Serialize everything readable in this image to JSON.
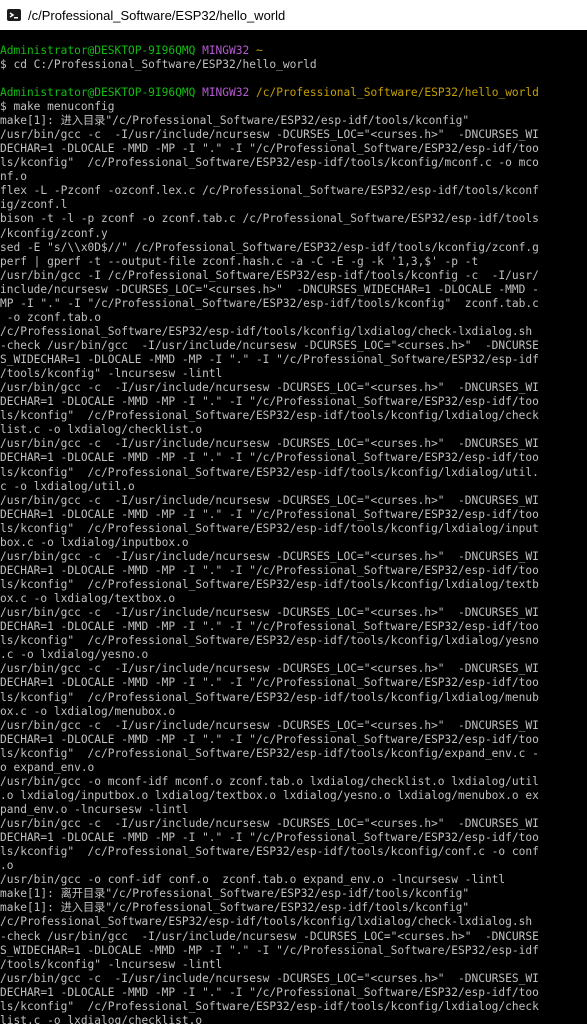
{
  "window": {
    "title": "/c/Professional_Software/ESP32/hello_world"
  },
  "prompt": {
    "user_host": "Administrator@DESKTOP-9I96QMQ",
    "shell": "MINGW32",
    "home": "~",
    "cwd": "/c/Professional_Software/ESP32/hello_world",
    "cmd_cd": "$ cd C:/Professional_Software/ESP32/hello_world",
    "cmd_make": "$ make menuconfig"
  },
  "output": [
    "make[1]: 进入目录\"/c/Professional_Software/ESP32/esp-idf/tools/kconfig\"",
    "/usr/bin/gcc -c  -I/usr/include/ncursesw -DCURSES_LOC=\"<curses.h>\"  -DNCURSES_WI",
    "DECHAR=1 -DLOCALE -MMD -MP -I \".\" -I \"/c/Professional_Software/ESP32/esp-idf/too",
    "ls/kconfig\"  /c/Professional_Software/ESP32/esp-idf/tools/kconfig/mconf.c -o mco",
    "nf.o",
    "flex -L -Pzconf -ozconf.lex.c /c/Professional_Software/ESP32/esp-idf/tools/kconf",
    "ig/zconf.l",
    "bison -t -l -p zconf -o zconf.tab.c /c/Professional_Software/ESP32/esp-idf/tools",
    "/kconfig/zconf.y",
    "sed -E \"s/\\\\x0D$//\" /c/Professional_Software/ESP32/esp-idf/tools/kconfig/zconf.g",
    "perf | gperf -t --output-file zconf.hash.c -a -C -E -g -k '1,3,$' -p -t",
    "/usr/bin/gcc -I /c/Professional_Software/ESP32/esp-idf/tools/kconfig -c  -I/usr/",
    "include/ncursesw -DCURSES_LOC=\"<curses.h>\"  -DNCURSES_WIDECHAR=1 -DLOCALE -MMD -",
    "MP -I \".\" -I \"/c/Professional_Software/ESP32/esp-idf/tools/kconfig\"  zconf.tab.c",
    " -o zconf.tab.o",
    "/c/Professional_Software/ESP32/esp-idf/tools/kconfig/lxdialog/check-lxdialog.sh",
    "-check /usr/bin/gcc  -I/usr/include/ncursesw -DCURSES_LOC=\"<curses.h>\"  -DNCURSE",
    "S_WIDECHAR=1 -DLOCALE -MMD -MP -I \".\" -I \"/c/Professional_Software/ESP32/esp-idf",
    "/tools/kconfig\" -lncursesw -lintl",
    "/usr/bin/gcc -c  -I/usr/include/ncursesw -DCURSES_LOC=\"<curses.h>\"  -DNCURSES_WI",
    "DECHAR=1 -DLOCALE -MMD -MP -I \".\" -I \"/c/Professional_Software/ESP32/esp-idf/too",
    "ls/kconfig\"  /c/Professional_Software/ESP32/esp-idf/tools/kconfig/lxdialog/check",
    "list.c -o lxdialog/checklist.o",
    "/usr/bin/gcc -c  -I/usr/include/ncursesw -DCURSES_LOC=\"<curses.h>\"  -DNCURSES_WI",
    "DECHAR=1 -DLOCALE -MMD -MP -I \".\" -I \"/c/Professional_Software/ESP32/esp-idf/too",
    "ls/kconfig\"  /c/Professional_Software/ESP32/esp-idf/tools/kconfig/lxdialog/util.",
    "c -o lxdialog/util.o",
    "/usr/bin/gcc -c  -I/usr/include/ncursesw -DCURSES_LOC=\"<curses.h>\"  -DNCURSES_WI",
    "DECHAR=1 -DLOCALE -MMD -MP -I \".\" -I \"/c/Professional_Software/ESP32/esp-idf/too",
    "ls/kconfig\"  /c/Professional_Software/ESP32/esp-idf/tools/kconfig/lxdialog/input",
    "box.c -o lxdialog/inputbox.o",
    "/usr/bin/gcc -c  -I/usr/include/ncursesw -DCURSES_LOC=\"<curses.h>\"  -DNCURSES_WI",
    "DECHAR=1 -DLOCALE -MMD -MP -I \".\" -I \"/c/Professional_Software/ESP32/esp-idf/too",
    "ls/kconfig\"  /c/Professional_Software/ESP32/esp-idf/tools/kconfig/lxdialog/textb",
    "ox.c -o lxdialog/textbox.o",
    "/usr/bin/gcc -c  -I/usr/include/ncursesw -DCURSES_LOC=\"<curses.h>\"  -DNCURSES_WI",
    "DECHAR=1 -DLOCALE -MMD -MP -I \".\" -I \"/c/Professional_Software/ESP32/esp-idf/too",
    "ls/kconfig\"  /c/Professional_Software/ESP32/esp-idf/tools/kconfig/lxdialog/yesno",
    ".c -o lxdialog/yesno.o",
    "/usr/bin/gcc -c  -I/usr/include/ncursesw -DCURSES_LOC=\"<curses.h>\"  -DNCURSES_WI",
    "DECHAR=1 -DLOCALE -MMD -MP -I \".\" -I \"/c/Professional_Software/ESP32/esp-idf/too",
    "ls/kconfig\"  /c/Professional_Software/ESP32/esp-idf/tools/kconfig/lxdialog/menub",
    "ox.c -o lxdialog/menubox.o",
    "/usr/bin/gcc -c  -I/usr/include/ncursesw -DCURSES_LOC=\"<curses.h>\"  -DNCURSES_WI",
    "DECHAR=1 -DLOCALE -MMD -MP -I \".\" -I \"/c/Professional_Software/ESP32/esp-idf/too",
    "ls/kconfig\"  /c/Professional_Software/ESP32/esp-idf/tools/kconfig/expand_env.c -",
    "o expand_env.o",
    "/usr/bin/gcc -o mconf-idf mconf.o zconf.tab.o lxdialog/checklist.o lxdialog/util",
    ".o lxdialog/inputbox.o lxdialog/textbox.o lxdialog/yesno.o lxdialog/menubox.o ex",
    "pand_env.o -lncursesw -lintl",
    "/usr/bin/gcc -c  -I/usr/include/ncursesw -DCURSES_LOC=\"<curses.h>\"  -DNCURSES_WI",
    "DECHAR=1 -DLOCALE -MMD -MP -I \".\" -I \"/c/Professional_Software/ESP32/esp-idf/too",
    "ls/kconfig\"  /c/Professional_Software/ESP32/esp-idf/tools/kconfig/conf.c -o conf",
    ".o",
    "/usr/bin/gcc -o conf-idf conf.o  zconf.tab.o expand_env.o -lncursesw -lintl",
    "make[1]: 离开目录\"/c/Professional_Software/ESP32/esp-idf/tools/kconfig\"",
    "make[1]: 进入目录\"/c/Professional_Software/ESP32/esp-idf/tools/kconfig\"",
    "/c/Professional_Software/ESP32/esp-idf/tools/kconfig/lxdialog/check-lxdialog.sh",
    "-check /usr/bin/gcc  -I/usr/include/ncursesw -DCURSES_LOC=\"<curses.h>\"  -DNCURSE",
    "S_WIDECHAR=1 -DLOCALE -MMD -MP -I \".\" -I \"/c/Professional_Software/ESP32/esp-idf",
    "/tools/kconfig\" -lncursesw -lintl",
    "/usr/bin/gcc -c  -I/usr/include/ncursesw -DCURSES_LOC=\"<curses.h>\"  -DNCURSES_WI",
    "DECHAR=1 -DLOCALE -MMD -MP -I \".\" -I \"/c/Professional_Software/ESP32/esp-idf/too",
    "ls/kconfig\"  /c/Professional_Software/ESP32/esp-idf/tools/kconfig/lxdialog/check",
    "list.c -o lxdialog/checklist.o"
  ]
}
